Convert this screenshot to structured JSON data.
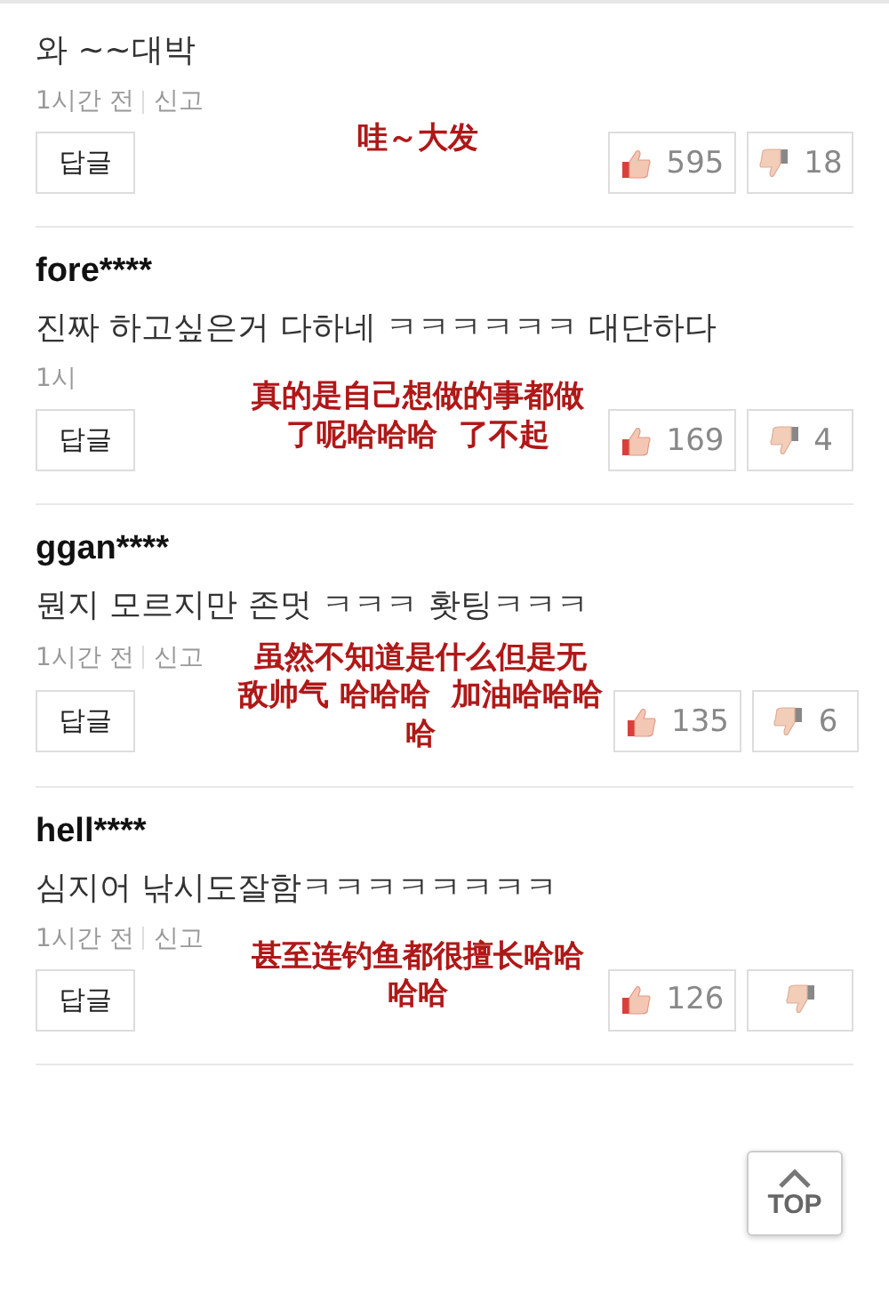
{
  "comments": [
    {
      "text": "와 ~~대박",
      "time": "1시간 전",
      "report": "신고",
      "reply": "답글",
      "caption": [
        "哇～大发"
      ],
      "likes": "595",
      "dislikes": "18"
    },
    {
      "user": "fore****",
      "text": "진짜 하고싶은거 다하네 ㅋㅋㅋㅋㅋㅋ 대단하다",
      "time": "1시",
      "reply": "답글",
      "caption": [
        "真的是自己想做的事都做",
        "了呢哈哈哈  了不起"
      ],
      "likes": "169",
      "dislikes": "4"
    },
    {
      "user": "ggan****",
      "text": "뭔지 모르지만 존멋 ㅋㅋㅋ 홧팅ㅋㅋㅋ",
      "time": "1시간 전",
      "report": "신고",
      "reply": "답글",
      "caption": [
        "虽然不知道是什么但是无",
        "敌帅气 哈哈哈  加油哈哈哈",
        "哈"
      ],
      "likes": "135",
      "dislikes": "6"
    },
    {
      "user": "hell****",
      "text": "심지어 낚시도잘함ㅋㅋㅋㅋㅋㅋㅋㅋ",
      "time": "1시간 전",
      "report": "신고",
      "reply": "답글",
      "caption": [
        "甚至连钓鱼都很擅长哈哈",
        "哈哈"
      ],
      "likes": "126"
    }
  ],
  "top_button": "TOP"
}
